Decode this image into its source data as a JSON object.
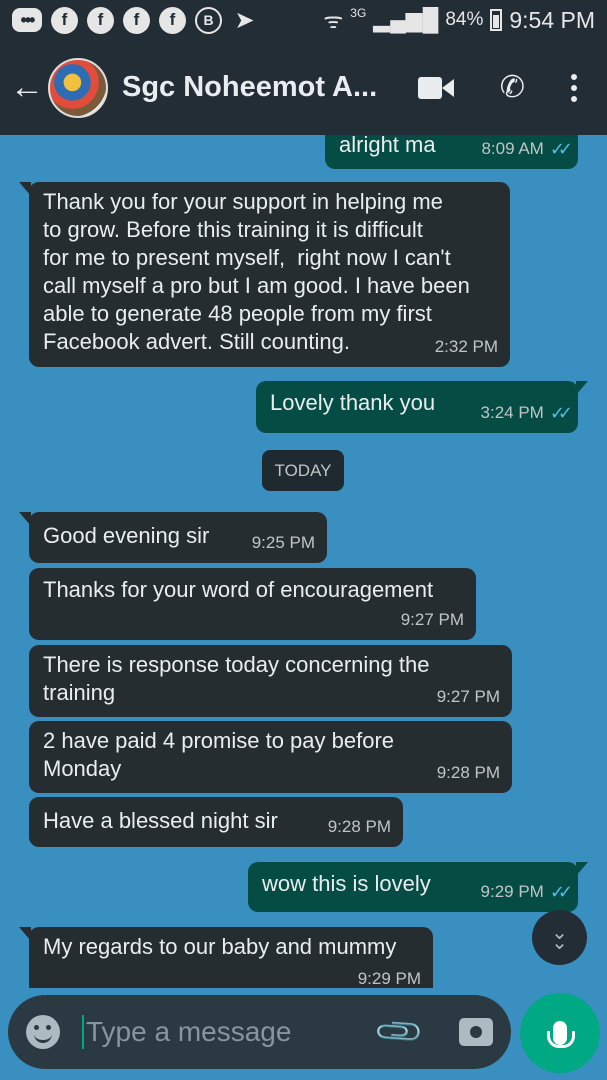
{
  "status_bar": {
    "icons": [
      {
        "name": "chat-icon",
        "glyph": "•••"
      },
      {
        "name": "facebook-icon",
        "glyph": "f"
      },
      {
        "name": "facebook-icon",
        "glyph": "f"
      },
      {
        "name": "facebook-icon",
        "glyph": "f"
      },
      {
        "name": "facebook-icon",
        "glyph": "f"
      },
      {
        "name": "b-icon",
        "glyph": "B"
      },
      {
        "name": "telegram-icon",
        "glyph": "➤"
      }
    ],
    "network": "3G",
    "battery": "84%",
    "time": "9:54 PM"
  },
  "header": {
    "title": "Sgc Noheemot A..."
  },
  "date_chip": "TODAY",
  "messages": [
    {
      "direction": "out",
      "text": "alright ma",
      "time": "8:09 AM",
      "read": true
    },
    {
      "direction": "in",
      "text": "Thank you for your support in helping me\nto grow. Before this training it is difficult\nfor me to present myself,  right now I can't\ncall myself a pro but I am good. I have been\nable to generate 48 people from my first\nFacebook advert. Still counting.",
      "time": "2:32 PM"
    },
    {
      "direction": "out",
      "text": "Lovely thank you",
      "time": "3:24 PM",
      "read": true
    },
    {
      "direction": "in",
      "text": "Good evening sir",
      "time": "9:25 PM"
    },
    {
      "direction": "in",
      "text": "Thanks for your word of encouragement",
      "time": "9:27 PM"
    },
    {
      "direction": "in",
      "text": "There is response today concerning the\ntraining",
      "time": "9:27 PM"
    },
    {
      "direction": "in",
      "text": "2 have paid 4 promise to pay before\nMonday",
      "time": "9:28 PM"
    },
    {
      "direction": "in",
      "text": "Have a blessed night sir",
      "time": "9:28 PM"
    },
    {
      "direction": "out",
      "text": "wow this is lovely",
      "time": "9:29 PM",
      "read": true
    },
    {
      "direction": "in",
      "text": "My regards to our baby and mummy",
      "time": "9:29 PM"
    }
  ],
  "input": {
    "placeholder": "Type a message"
  },
  "colors": {
    "wallpaper": "#3a8fc1",
    "bar": "#232d36",
    "incoming": "#262d31",
    "outgoing": "#054d44",
    "accent": "#00a884",
    "read_ticks": "#53bdeb"
  }
}
